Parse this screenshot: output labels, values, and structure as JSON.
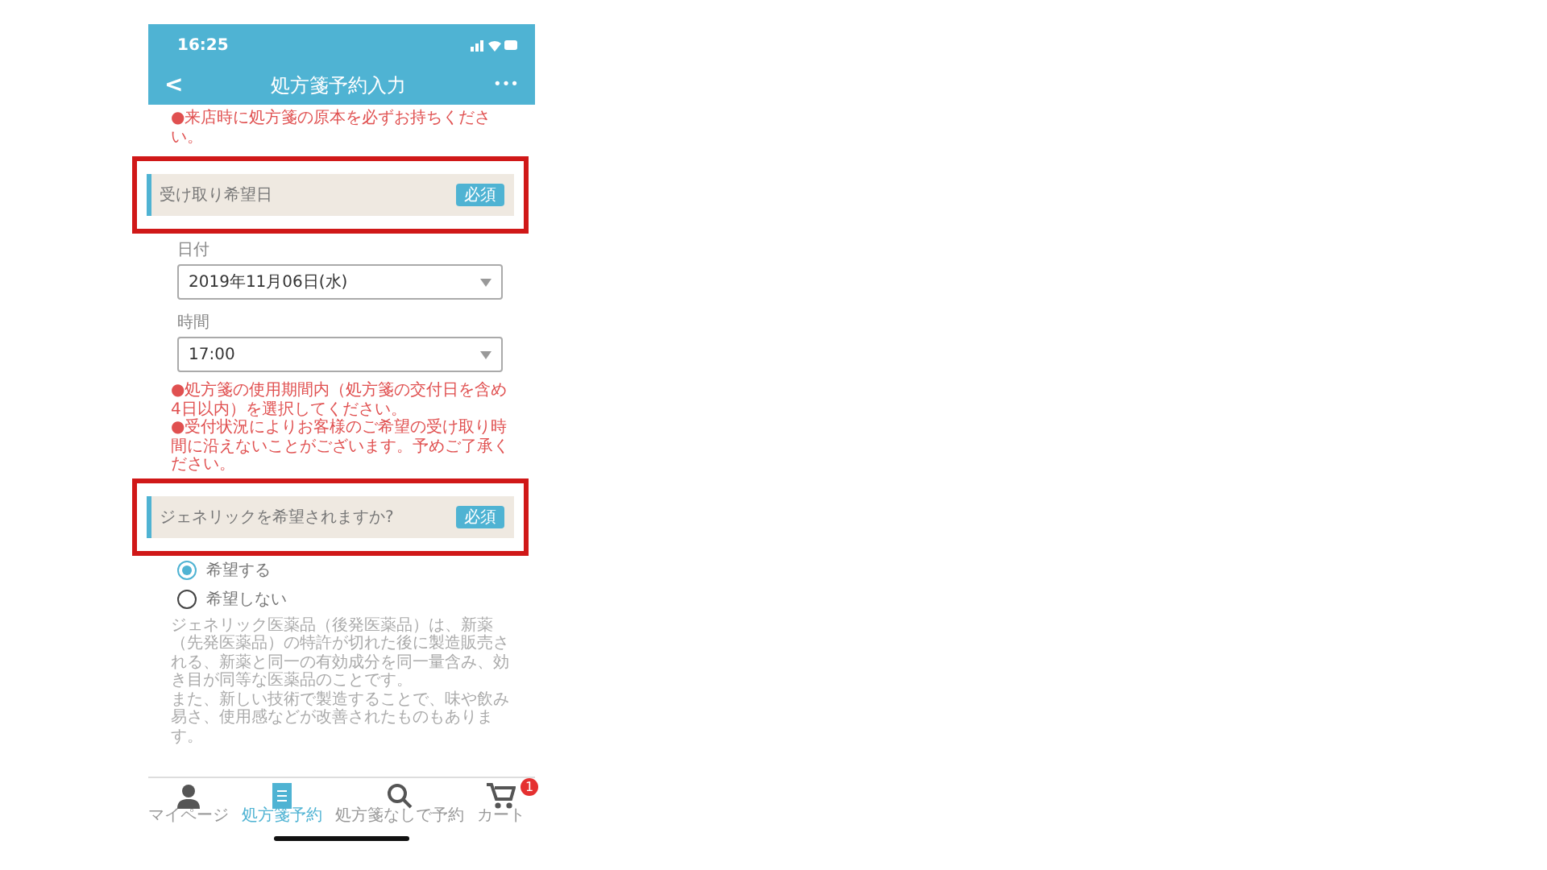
{
  "status_bar": {
    "time": "16:25"
  },
  "header": {
    "back": "<",
    "title": "処方箋予約入力",
    "menu": "•••"
  },
  "top_note": "●来店時に処方箋の原本を必ずお持ちください。",
  "sections": [
    {
      "title": "受け取り希望日",
      "badge": "必須",
      "highlighted": true
    },
    {
      "title": "ジェネリックを希望されますか?",
      "badge": "必須",
      "highlighted": true
    }
  ],
  "fields": [
    {
      "label": "日付",
      "value": "2019年11月06日(水)"
    },
    {
      "label": "時間",
      "value": "17:00"
    }
  ],
  "pickup_notes": [
    "●処方箋の使用期間内（処方箋の交付日を含め4日以内）を選択してください。",
    "●受付状況によりお客様のご希望の受け取り時間に沿えないことがございます。予めご了承ください。"
  ],
  "generic_options": [
    {
      "label": "希望する",
      "selected": true
    },
    {
      "label": "希望しない",
      "selected": false
    }
  ],
  "generic_description": [
    "ジェネリック医薬品（後発医薬品）は、新薬（先発医薬品）の特許が切れた後に製造販売される、新薬と同一の有効成分を同一量含み、効き目が同等な医薬品のことです。",
    "また、新しい技術で製造することで、味や飲み易さ、使用感などが改善されたものもあります。"
  ],
  "tab_bar": [
    {
      "kind": "person",
      "label": "マイページ",
      "selected": false
    },
    {
      "kind": "document",
      "label": "処方箋予約",
      "selected": true
    },
    {
      "kind": "search",
      "label": "処方箋なしで予約",
      "selected": false
    },
    {
      "kind": "cart",
      "label": "カート",
      "selected": false,
      "badge": "1"
    }
  ]
}
